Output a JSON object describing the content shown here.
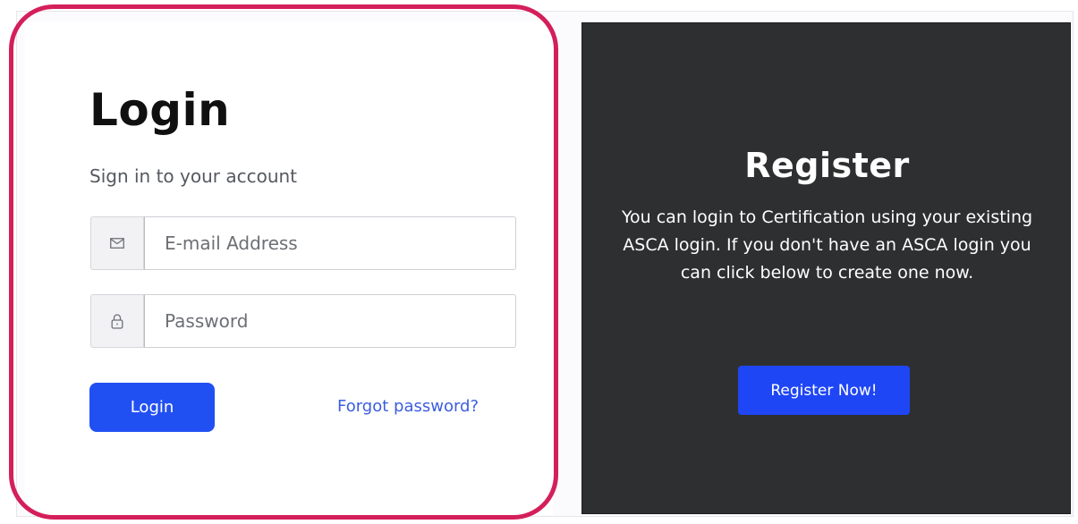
{
  "login": {
    "title": "Login",
    "subtitle": "Sign in to your account",
    "email_placeholder": "E-mail Address",
    "password_placeholder": "Password",
    "login_button": "Login",
    "forgot_link": "Forgot password?",
    "email_icon": "envelope-icon",
    "password_icon": "lock-icon"
  },
  "register": {
    "title": "Register",
    "description": "You can login to Certification using your existing ASCA login. If you don't have an ASCA login you can click below to create one now.",
    "button": "Register Now!"
  },
  "colors": {
    "highlight_ring": "#d41f5a",
    "primary_button": "#2150f2",
    "register_panel_bg": "#2e2f30",
    "link": "#3b5de0"
  }
}
